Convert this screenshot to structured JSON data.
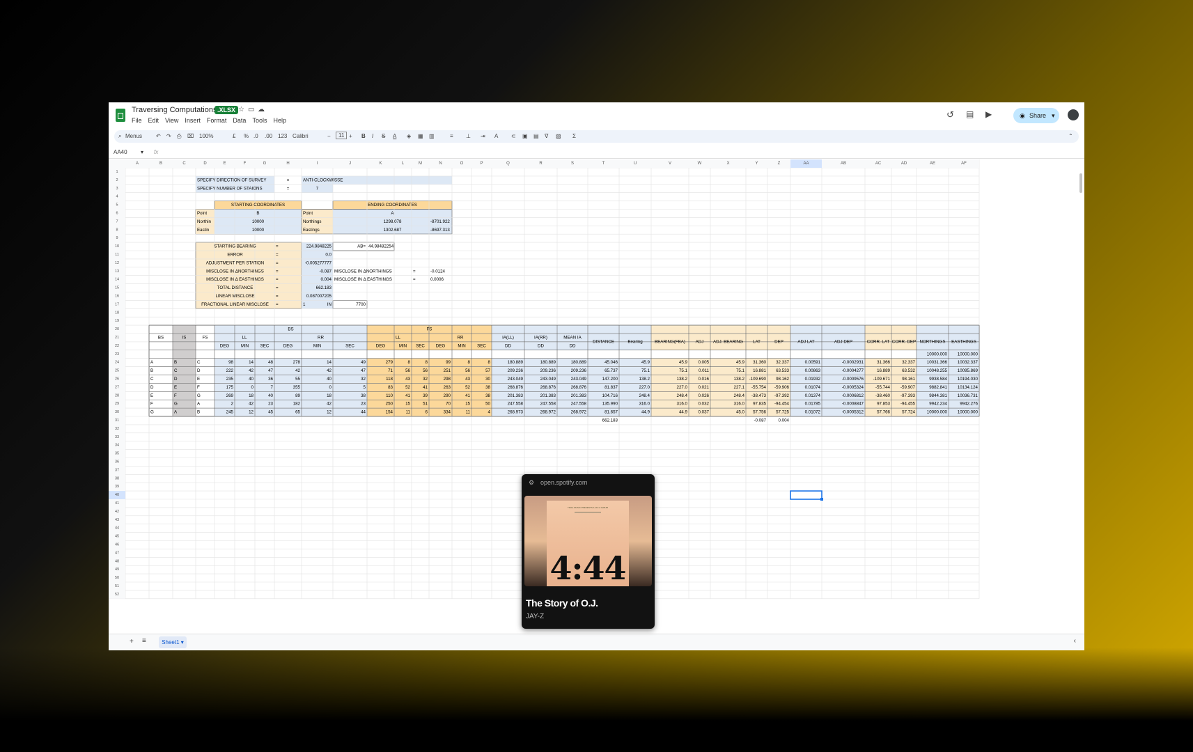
{
  "doc": {
    "title": "Traversing Computations",
    "badge": ".XLSX",
    "menus": [
      "File",
      "Edit",
      "View",
      "Insert",
      "Format",
      "Data",
      "Tools",
      "Help"
    ],
    "share": "Share"
  },
  "toolbar": {
    "search": "Menus",
    "zoom": "100%",
    "font": "Calibri",
    "size": "11",
    "currency": "£",
    "percent": "%",
    "dec1": ".0",
    "dec2": ".00",
    "fmt": "123"
  },
  "formula": {
    "cellref": "AA40",
    "fx": "fx"
  },
  "columns": [
    "A",
    "B",
    "C",
    "D",
    "E",
    "F",
    "G",
    "H",
    "I",
    "J",
    "K",
    "L",
    "M",
    "N",
    "O",
    "P",
    "Q",
    "R",
    "S",
    "T",
    "U",
    "V",
    "W",
    "X",
    "Y",
    "Z",
    "AA",
    "AB",
    "AC",
    "AD",
    "AE",
    "AF"
  ],
  "selected_col": "AA",
  "selected_row": "40",
  "rows_count": 52,
  "setup": {
    "dir_label": "SPECIFY DIRECTION OF SURVEY",
    "dir_eq": "=",
    "dir_val": "ANTI-CLOCKWISSE",
    "num_label": "SPECIFY NUMBER OF STAIONS",
    "num_eq": "=",
    "num_val": "7",
    "start_hdr": "STARTING COORDINATES",
    "end_hdr": "ENDING COORDINATES",
    "point": "Point",
    "start_pt": "B",
    "end_pt": "A",
    "north_short": "Northin",
    "east_short": "Eastin",
    "start_n": "10000",
    "start_e": "10000",
    "northings": "Northings",
    "eastings": "Eastings",
    "end_n": "1298.078",
    "end_e": "1302.687",
    "diff_n": "-8701.922",
    "diff_e": "-8697.313"
  },
  "params": {
    "labels": [
      "STARTING BEARING",
      "ERROR",
      "ADJUSTMENT PER STATION",
      "MISCLOSE IN ΔNORTHINGS",
      "MISCLOSE IN Δ EASTHINGS",
      "TOTAL DISTANCE",
      "LINEAR MISCLOSE",
      "FRACTIONAL LINEAR MISCLOSE"
    ],
    "eq": "=",
    "values": [
      "224.9848225",
      "0.0",
      "-0.005277777",
      "-0.087",
      "0.004",
      "662.183",
      "0.087007205",
      "1"
    ],
    "ab_label": "AB=",
    "ab_val": "44.98482254",
    "mn_label": "MISCLOSE IN ΔNORTHINGS",
    "mn_eq": "=",
    "mn_val": "-0.0124",
    "me_label": "MISCLOSE IN Δ EASTHINGS",
    "me_eq": "=",
    "me_val": "0.0006",
    "in_label": "IN",
    "in_val": "7700"
  },
  "table": {
    "h_bs": "BS",
    "h_is": "IS",
    "h_fs": "FS",
    "h_ll": "LL",
    "h_rr": "RR",
    "h_deg": "DEG",
    "h_min": "MIN",
    "h_sec": "SEC",
    "h_ia_ll": "IA(LL)",
    "h_ia_rr": "IA(RR)",
    "h_mean": "MEAN IA",
    "h_dd": "DD",
    "h_dist": "DISTANCE",
    "h_bearing": "Bearing",
    "h_fba": "BEARING(FBA)",
    "h_adj": "ADJ",
    "h_adjb": "ADJ. BEARING",
    "h_lat": "LAT",
    "h_dep": "DEP",
    "h_adjlat": "ADJ LAT",
    "h_adjdep": "ADJ DEP",
    "h_corrlat": "CORR. LAT",
    "h_corrdep": "CORR. DEP",
    "h_north": "NORTHINGS",
    "h_east": "EASTHINGS",
    "init_n": "10000.000",
    "init_e": "10000.000",
    "rows": [
      [
        "A",
        "B",
        "C",
        "98",
        "14",
        "48",
        "278",
        "14",
        "49",
        "279",
        "8",
        "8",
        "99",
        "8",
        "8",
        "180.889",
        "180.889",
        "180.889",
        "45.046",
        "45.9",
        "45.9",
        "0.005",
        "45.9",
        "31.360",
        "32.337",
        "0.00591",
        "-0.0002931",
        "31.366",
        "32.337",
        "10031.366",
        "10032.337"
      ],
      [
        "B",
        "C",
        "D",
        "222",
        "42",
        "47",
        "42",
        "42",
        "47",
        "71",
        "56",
        "56",
        "251",
        "56",
        "57",
        "209.236",
        "209.236",
        "209.236",
        "65.737",
        "75.1",
        "75.1",
        "0.011",
        "75.1",
        "16.881",
        "63.533",
        "0.00863",
        "-0.0004277",
        "16.889",
        "63.532",
        "10048.255",
        "10095.869"
      ],
      [
        "C",
        "D",
        "E",
        "235",
        "40",
        "36",
        "55",
        "40",
        "32",
        "118",
        "43",
        "32",
        "298",
        "43",
        "30",
        "243.049",
        "243.049",
        "243.049",
        "147.200",
        "138.2",
        "138.2",
        "0.016",
        "138.2",
        "-109.690",
        "98.162",
        "0.01932",
        "-0.0009576",
        "-109.671",
        "98.161",
        "9938.584",
        "10194.030"
      ],
      [
        "D",
        "E",
        "F",
        "175",
        "0",
        "7",
        "355",
        "0",
        "5",
        "83",
        "52",
        "41",
        "263",
        "52",
        "38",
        "268.876",
        "268.876",
        "268.876",
        "81.837",
        "227.0",
        "227.0",
        "0.021",
        "227.1",
        "-55.754",
        "-59.906",
        "0.01074",
        "-0.0005324",
        "-55.744",
        "-59.907",
        "9882.841",
        "10134.124"
      ],
      [
        "E",
        "F",
        "G",
        "269",
        "18",
        "40",
        "89",
        "18",
        "38",
        "110",
        "41",
        "39",
        "290",
        "41",
        "38",
        "201.383",
        "201.383",
        "201.383",
        "104.716",
        "248.4",
        "248.4",
        "0.026",
        "248.4",
        "-38.473",
        "-97.392",
        "0.01374",
        "-0.0006812",
        "-38.460",
        "-97.393",
        "9844.381",
        "10036.731"
      ],
      [
        "F",
        "G",
        "A",
        "2",
        "42",
        "23",
        "182",
        "42",
        "23",
        "250",
        "15",
        "51",
        "70",
        "15",
        "50",
        "247.558",
        "247.558",
        "247.558",
        "135.990",
        "316.0",
        "316.0",
        "0.032",
        "316.0",
        "97.835",
        "-94.454",
        "0.01785",
        "-0.0008847",
        "97.853",
        "-94.455",
        "9942.234",
        "9942.276"
      ],
      [
        "G",
        "A",
        "B",
        "245",
        "12",
        "45",
        "65",
        "12",
        "44",
        "154",
        "11",
        "6",
        "334",
        "11",
        "4",
        "268.973",
        "268.972",
        "268.972",
        "81.657",
        "44.9",
        "44.9",
        "0.037",
        "45.0",
        "57.756",
        "57.725",
        "0.01072",
        "-0.0005312",
        "57.766",
        "57.724",
        "10000.000",
        "10000.000"
      ]
    ],
    "sum_dist": "662.183",
    "sum_lat": "-0.087",
    "sum_dep": "0.004"
  },
  "sheet": {
    "tab": "Sheet1"
  },
  "spotify": {
    "url": "open.spotify.com",
    "album_text": "4:44",
    "album_top": "TIDAL MUSIC PRESENTS A JAY-Z ALBUM",
    "track": "The Story of O.J.",
    "artist": "JAY-Z"
  }
}
